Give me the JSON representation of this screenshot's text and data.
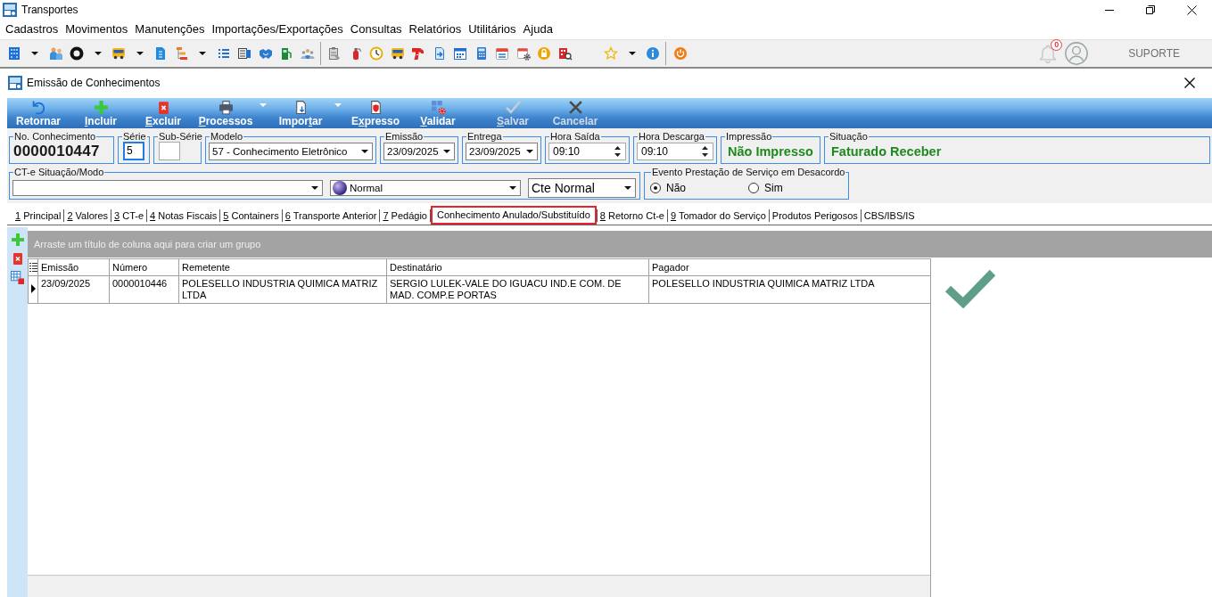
{
  "window": {
    "title": "Transportes"
  },
  "menu": [
    "Cadastros",
    "Movimentos",
    "Manutenções",
    "Importações/Exportações",
    "Consultas",
    "Relatórios",
    "Utilitários",
    "Ajuda"
  ],
  "user_area": {
    "notification_count": "0",
    "user": "SUPORTE"
  },
  "document": {
    "title": "Emissão de Conhecimentos"
  },
  "actions": [
    {
      "label_start": "Retornar",
      "disabled": false,
      "dropdown": false
    },
    {
      "accel": "I",
      "label_end": "ncluir",
      "disabled": false,
      "dropdown": false
    },
    {
      "accel": "E",
      "label_end": "xcluir",
      "disabled": false,
      "dropdown": false
    },
    {
      "accel": "P",
      "label_end": "rocessos",
      "disabled": false,
      "dropdown": true
    },
    {
      "label_start": "Impor",
      "accel": "t",
      "label_end": "ar",
      "disabled": false,
      "dropdown": true
    },
    {
      "label_start": "E",
      "accel": "x",
      "label_end": "presso",
      "disabled": false,
      "dropdown": false
    },
    {
      "accel": "V",
      "label_end": "alidar",
      "disabled": false,
      "dropdown": false
    },
    {
      "accel": "S",
      "label_end": "alvar",
      "disabled": true,
      "dropdown": false
    },
    {
      "label_start": "Cancelar",
      "disabled": true,
      "dropdown": false
    }
  ],
  "header_fields": [
    {
      "kind": "display",
      "label": "No. Conhecimento",
      "value": "0000010447"
    },
    {
      "kind": "input",
      "label": "Série",
      "value": "5",
      "focused": true
    },
    {
      "kind": "input",
      "label": "Sub-Série",
      "focused": false
    },
    {
      "kind": "dropdown",
      "label": "Modelo",
      "value": "57 - Conhecimento Eletrônico"
    },
    {
      "kind": "dropdown",
      "label": "Emissão",
      "value": "23/09/2025"
    },
    {
      "kind": "dropdown",
      "label": "Entrega",
      "value": "23/09/2025"
    },
    {
      "kind": "spinner",
      "label": "Hora Saída",
      "value": "09:10"
    },
    {
      "kind": "spinner",
      "label": "Hora Descarga",
      "value": "09:10"
    },
    {
      "kind": "status",
      "label": "Impressão",
      "value": "Não Impresso"
    },
    {
      "kind": "status",
      "label": "Situação",
      "value": "Faturado Receber"
    }
  ],
  "cte_group": {
    "label": "CT-e Situação/Modo",
    "selects": [
      {
        "kind": "plain"
      },
      {
        "kind": "icon",
        "value": "Normal"
      },
      {
        "kind": "large",
        "value": "Cte Normal"
      }
    ]
  },
  "evento": {
    "label": "Evento Prestação de Serviço em Desacordo",
    "options": [
      {
        "label": "Não",
        "selected": true
      },
      {
        "label": "Sim",
        "selected": false
      }
    ]
  },
  "tabs": [
    {
      "accel": "1",
      "label": "Principal",
      "selected": false
    },
    {
      "accel": "2",
      "label": "Valores",
      "selected": false
    },
    {
      "accel": "3",
      "label": "CT-e",
      "selected": false
    },
    {
      "accel": "4",
      "label": "Notas Fiscais",
      "selected": false
    },
    {
      "accel": "5",
      "label": "Containers",
      "selected": false
    },
    {
      "accel": "6",
      "label": "Transporte Anterior",
      "selected": false
    },
    {
      "accel": "7",
      "label": "Pedágio",
      "selected": false
    },
    {
      "label": "Conhecimento Anulado/Substituído",
      "selected": true
    },
    {
      "accel": "8",
      "label": "Retorno Ct-e",
      "selected": false
    },
    {
      "accel": "9",
      "label": "Tomador do Serviço",
      "selected": false
    },
    {
      "label": "Produtos Perigosos",
      "selected": false
    },
    {
      "label": "CBS/IBS/IS",
      "selected": false
    }
  ],
  "grid": {
    "group_hint": "Arraste um título de coluna aqui para criar um grupo",
    "columns": [
      "Emissão",
      "Número",
      "Remetente",
      "Destinatário",
      "Pagador"
    ],
    "rows": [
      {
        "current": true,
        "cells": [
          "23/09/2025",
          "0000010446",
          "POLESELLO INDUSTRIA QUIMICA MATRIZ LTDA",
          "SERGIO LULEK-VALE DO IGUACU IND.E COM. DE MAD. COMP.E PORTAS",
          "POLESELLO INDUSTRIA QUIMICA MATRIZ LTDA"
        ]
      }
    ]
  }
}
